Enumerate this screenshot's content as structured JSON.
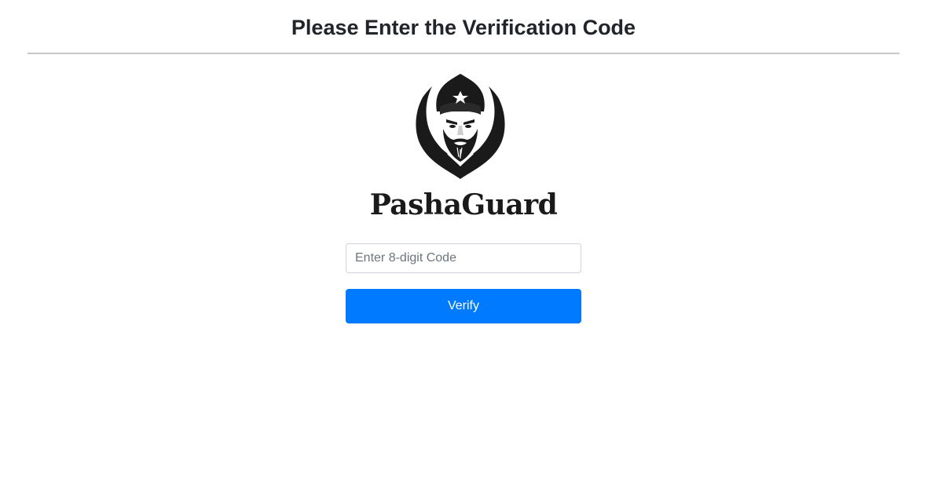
{
  "header": {
    "title": "Please Enter the Verification Code"
  },
  "brand": {
    "logo_icon": "bearded-guard-emblem-icon",
    "name": "PashaGuard"
  },
  "form": {
    "code_input": {
      "value": "",
      "placeholder": "Enter 8-digit Code"
    },
    "verify_label": "Verify"
  },
  "colors": {
    "accent": "#007bff",
    "text": "#212529",
    "divider": "#c8c8c8"
  }
}
